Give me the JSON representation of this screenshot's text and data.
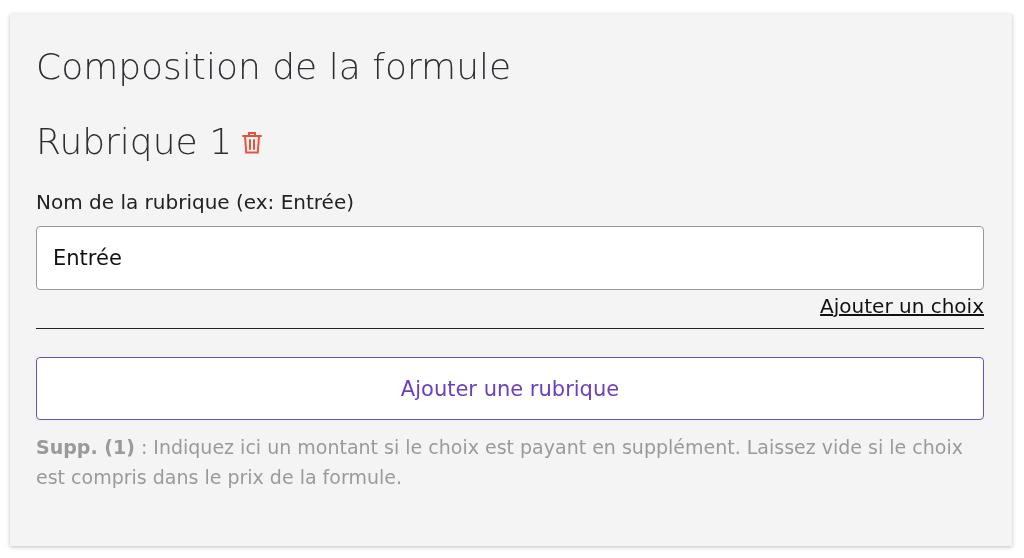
{
  "section_title": "Composition de la formule",
  "rubriques": [
    {
      "title": "Rubrique 1",
      "name_label": "Nom de la rubrique (ex: Entrée)",
      "name_value": "Entrée",
      "add_choice_link": "Ajouter un choix"
    }
  ],
  "add_rubrique_button": "Ajouter une rubrique",
  "note": "**Supp. (1)** : Indiquez ici un montant si le choix est payant en supplément. Laissez vide si le choix est compris dans le prix de la formule."
}
